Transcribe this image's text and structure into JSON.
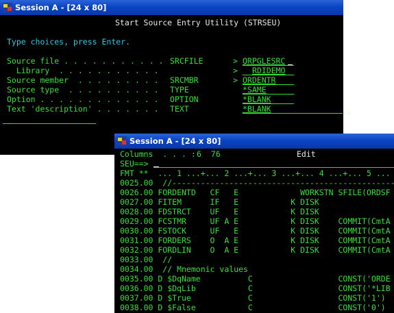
{
  "window1": {
    "title": "Session A - [24 x 80]",
    "heading": "Start Source Entry Utility (STRSEU)",
    "instruction": "Type choices, press Enter.",
    "fields": [
      {
        "label": "Source file . . . . . . . . . . .",
        "keyword": "SRCFILE",
        "prompt": ">",
        "value": "QRPGLESRC"
      },
      {
        "label": "  Library  . . . . . . . . . . .",
        "keyword": "",
        "prompt": ">",
        "value": "RDIDEMO"
      },
      {
        "label": "Source member  . . . . . . . . .",
        "keyword": "SRCMBR",
        "prompt": ">",
        "value": "ORDENTR"
      },
      {
        "label": "Source type  . . . . . . . . . .",
        "keyword": "TYPE",
        "prompt": "",
        "value": "*SAME"
      },
      {
        "label": "Option . . . . . . . . . . . . .",
        "keyword": "OPTION",
        "prompt": "",
        "value": "*BLANK"
      },
      {
        "label": "Text 'description' . . . . . . .",
        "keyword": "TEXT",
        "prompt": "",
        "value": "*BLANK"
      }
    ]
  },
  "window2": {
    "title": "Session A - [24 x 80]",
    "columns_label": "Columns  . . . :",
    "columns_value": "6  76",
    "mode": "Edit",
    "command_prompt": "SEU==>",
    "format_ruler": "FMT **  ... 1 ...+... 2 ...+... 3 ...+... 4 ...+... 5 ...",
    "lines": [
      "0025.00  //------------------------------------------------------",
      "0026.00 FORDENTD   CF   E             WORKSTN SFILE(ORDSF",
      "0027.00 FITEM      IF   E           K DISK",
      "0028.00 FDSTRCT    UF   E           K DISK",
      "0029.00 FCSTMR     UF A E           K DISK    COMMIT(CmtA",
      "0030.00 FSTOCK     UF   E           K DISK    COMMIT(CmtA",
      "0031.00 FORDERS    O  A E           K DISK    COMMIT(CmtA",
      "0032.00 FORDLIN    O  A E           K DISK    COMMIT(CmtA",
      "0033.00  //",
      "0034.00  // Mnemonic values",
      "0035.00 D $DqName          C                  CONST('ORDE",
      "0036.00 D $DqLib           C                  CONST('*LIB",
      "0037.00 D $True            C                  CONST('1')",
      "0038.00 D $False           C                  CONST('0')"
    ]
  }
}
